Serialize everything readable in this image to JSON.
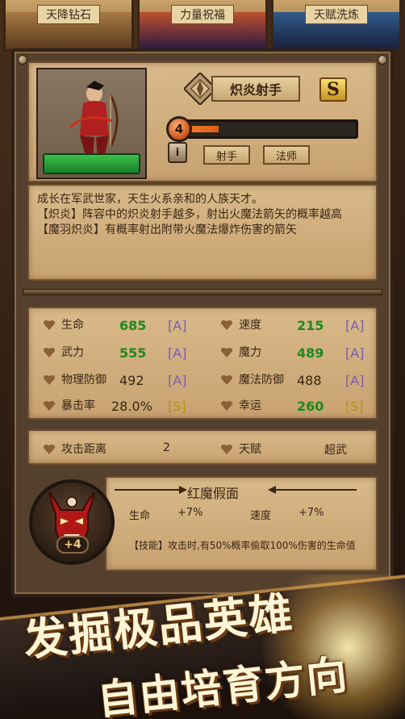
{
  "top_tabs": [
    {
      "label": "天降钻石"
    },
    {
      "label": "力量祝福"
    },
    {
      "label": "天赋洗炼"
    }
  ],
  "hero": {
    "name": "炽炎射手",
    "rank": "S",
    "level": "4",
    "xp_fraction": 0.17,
    "tags": [
      "射手",
      "法师"
    ],
    "info_label": "i"
  },
  "description": [
    "成长在军武世家，天生火系亲和的人族天才。",
    "【炽炎】阵容中的炽炎射手越多，射出火魔法箭矢的概率越高",
    "【魔羽炽炎】有概率射出附带火魔法爆炸伤害的箭矢"
  ],
  "stats": [
    {
      "label": "生命",
      "value": "685",
      "grade": "[A]",
      "value_color": "green",
      "grade_color": "purple"
    },
    {
      "label": "速度",
      "value": "215",
      "grade": "[A]",
      "value_color": "green",
      "grade_color": "purple"
    },
    {
      "label": "武力",
      "value": "555",
      "grade": "[A]",
      "value_color": "green",
      "grade_color": "purple"
    },
    {
      "label": "魔力",
      "value": "489",
      "grade": "[A]",
      "value_color": "green",
      "grade_color": "purple"
    },
    {
      "label": "物理防御",
      "value": "492",
      "grade": "[A]",
      "value_color": "dark",
      "grade_color": "purple"
    },
    {
      "label": "魔法防御",
      "value": "488",
      "grade": "[A]",
      "value_color": "dark",
      "grade_color": "purple"
    },
    {
      "label": "暴击率",
      "value": "28.0%",
      "grade": "[S]",
      "value_color": "dark",
      "grade_color": "yellow"
    },
    {
      "label": "幸运",
      "value": "260",
      "grade": "[S]",
      "value_color": "green",
      "grade_color": "yellow"
    }
  ],
  "range": {
    "attack_label": "攻击距离",
    "attack_value": "2",
    "talent_label": "天赋",
    "talent_value": "超武"
  },
  "equipment": {
    "name": "红魔假面",
    "enhance": "+4",
    "bonus1_label": "生命",
    "bonus1_value": "+7%",
    "bonus2_label": "速度",
    "bonus2_value": "+7%",
    "skill_text": "【技能】攻击时,有50%概率偷取100%伤害的生命值"
  },
  "promo": {
    "line1": "发掘极品英雄",
    "line2": "自由培育方向"
  },
  "colors": {
    "green": "#1c8a1c",
    "purple": "#7a5cb0",
    "yellow": "#b89010",
    "xp": "#f07a2a"
  }
}
